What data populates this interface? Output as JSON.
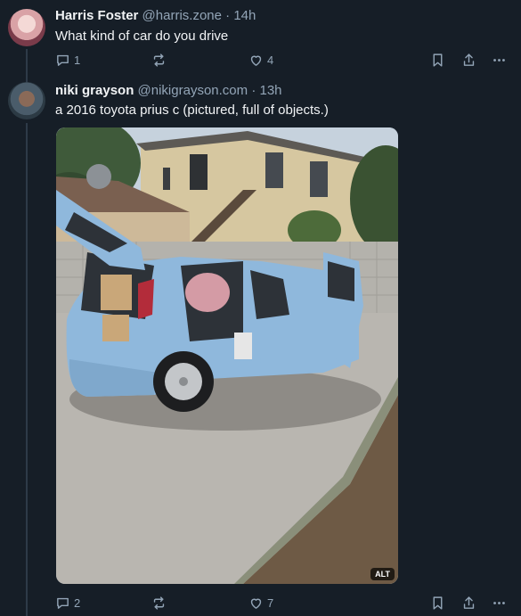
{
  "posts": [
    {
      "author_name": "Harris Foster",
      "handle": "@harris.zone",
      "separator": "·",
      "time": "14h",
      "text": "What kind of car do you drive",
      "reply_count": "1",
      "repost_count": "",
      "like_count": "4"
    },
    {
      "author_name": "niki grayson",
      "handle": "@nikigrayson.com",
      "separator": "·",
      "time": "13h",
      "text": "a 2016 toyota prius c (pictured, full of objects.)",
      "reply_count": "2",
      "repost_count": "",
      "like_count": "7",
      "image": {
        "alt_badge": "ALT"
      }
    }
  ],
  "icons": [
    "reply-icon",
    "repost-icon",
    "heart-icon",
    "bookmark-icon",
    "share-icon",
    "more-icon"
  ],
  "colors": {
    "background": "#161e27",
    "muted_text": "#93a5b7",
    "text": "#f1f3f5",
    "thread_line": "#2e3a48"
  }
}
